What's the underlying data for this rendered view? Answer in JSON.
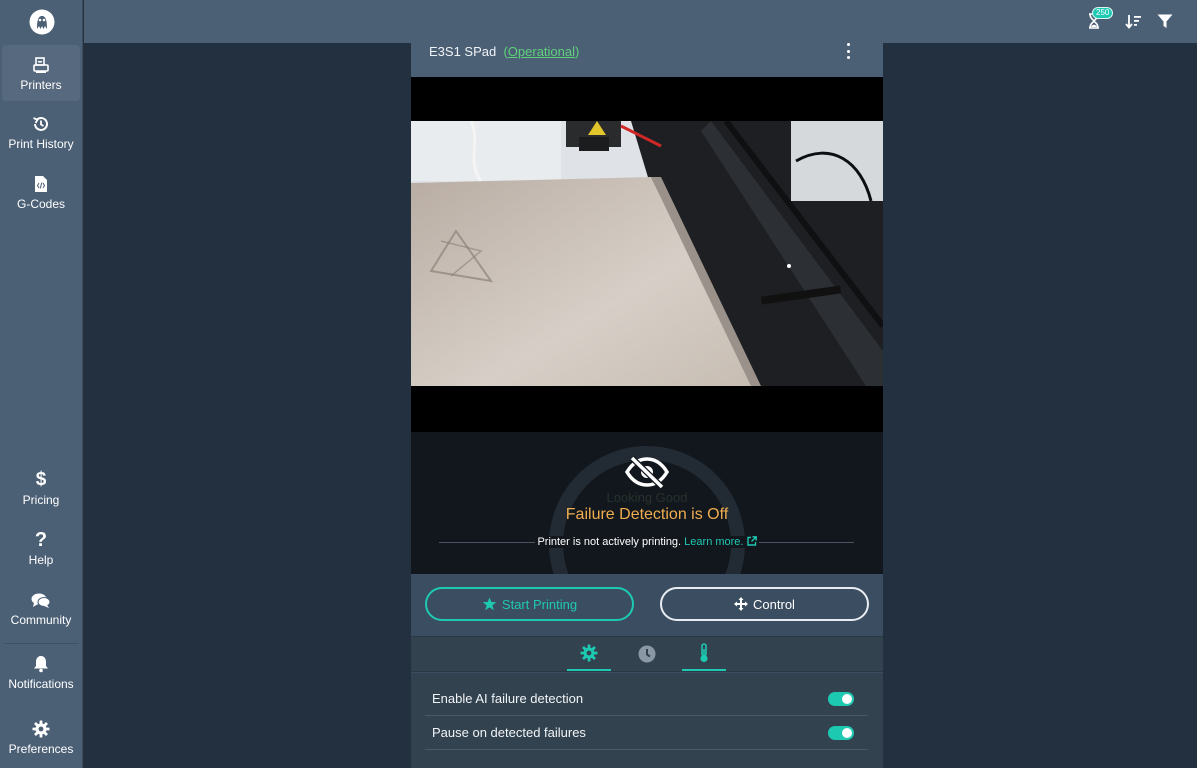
{
  "sidebar": {
    "items": [
      {
        "label": "Printers",
        "icon": "printer-icon",
        "active": true
      },
      {
        "label": "Print History",
        "icon": "history-icon"
      },
      {
        "label": "G-Codes",
        "icon": "code-file-icon"
      },
      {
        "label": "Pricing",
        "icon": "dollar-icon"
      },
      {
        "label": "Help",
        "icon": "question-icon"
      },
      {
        "label": "Community",
        "icon": "comments-icon"
      },
      {
        "label": "Notifications",
        "icon": "bell-icon"
      },
      {
        "label": "Preferences",
        "icon": "gear-icon"
      }
    ]
  },
  "topbar": {
    "hourglass_badge": "250",
    "icons": [
      "hourglass-icon",
      "sort-icon",
      "filter-icon"
    ]
  },
  "printer": {
    "name": "E3S1 SPad",
    "status": "Operational",
    "status_open": "(",
    "status_close": ")"
  },
  "detection": {
    "gauge_label": "Looking Good",
    "title": "Failure Detection is Off",
    "message": "Printer is not actively printing.",
    "learn_more": "Learn more."
  },
  "actions": {
    "start_label": "Start Printing",
    "control_label": "Control"
  },
  "tabs": [
    "gear-icon",
    "clock-icon",
    "thermometer-icon"
  ],
  "settings": [
    {
      "label": "Enable AI failure detection",
      "enabled": true
    },
    {
      "label": "Pause on detected failures",
      "enabled": true
    }
  ],
  "colors": {
    "accent": "#1ec9b2",
    "warning": "#f0ad4e",
    "status_ok": "#5ed17a",
    "sidebar": "#4b5f75",
    "background": "#22303f"
  }
}
